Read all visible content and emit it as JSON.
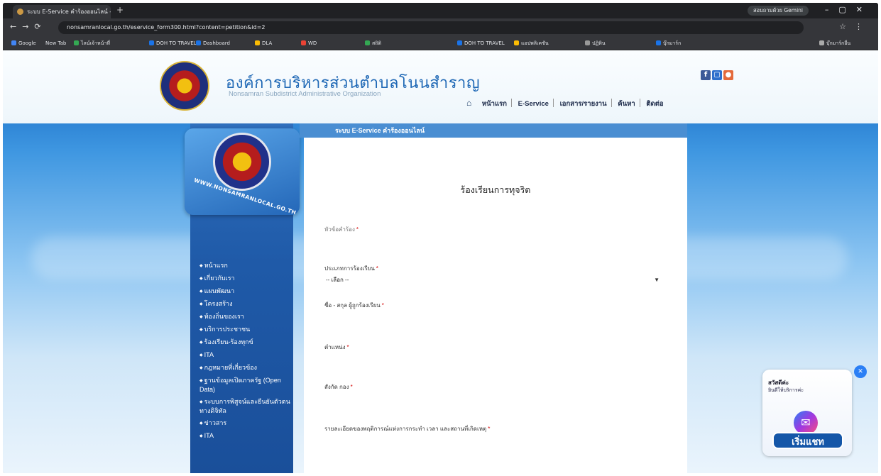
{
  "browser": {
    "tab_title": "ระบบ E-Service คำร้องออนไลน์ - ×",
    "gemini_label": "สอบถามด้วย Gemini",
    "address": "nonsamranlocal.go.th/eservice_form300.html?content=petition&id=2",
    "bookmarks": [
      "Google",
      "New Tab",
      "ไลน์เจ้าหน้าที่",
      "DOH TO TRAVEL",
      "Dashboard",
      "DLA",
      "WD",
      "สถิติ",
      "DOH TO TRAVEL",
      "แอปพลิเคชัน",
      "ปฏิทิน",
      "บุ๊กมาร์ก"
    ],
    "all_bookmarks": "บุ๊กมาร์กอื่น"
  },
  "header": {
    "site_title": "องค์การบริหารส่วนตำบลโนนสำราญ",
    "site_subtitle": "Nonsamran Subdistrict Administrative Organization",
    "nav": [
      "หน้าแรก",
      "E-Service",
      "เอกสาร/รายงาน",
      "ค้นหา",
      "ติดต่อ"
    ]
  },
  "band": {
    "eservice_title": "ระบบ E-Service คำร้องออนไลน์",
    "emblem_text": "WWW.NONSAMRANLOCAL.GO.TH"
  },
  "sidebar": {
    "items": [
      "หน้าแรก",
      "เกี่ยวกับเรา",
      "แผนพัฒนา",
      "โครงสร้าง",
      "ท้องถิ่นของเรา",
      "บริการประชาชน",
      "ร้องเรียน-ร้องทุกข์",
      "ITA",
      "กฎหมายที่เกี่ยวข้อง",
      "ฐานข้อมูลเปิดภาครัฐ (Open Data)",
      "ระบบการพิสูจน์และยืนยันตัวตนทางดิจิทัล",
      "ข่าวสาร",
      "ITA"
    ]
  },
  "form": {
    "title": "ร้องเรียนการทุจริต",
    "field_subject": "หัวข้อคำร้อง",
    "field_type": "ประเภทการร้องเรียน",
    "select_value": "-- เลือก --",
    "field_name": "ชื่อ - สกุล ผู้ถูกร้องเรียน",
    "field_position": "ตำแหน่ง",
    "field_dept": "สังกัด กอง",
    "field_details": "รายละเอียดของพฤติการณ์แห่งการกระทำ เวลา และสถานที่เกิดเหตุ",
    "required_mark": "*"
  },
  "chat": {
    "line1": "สวัสดีค่ะ",
    "line2": "ยินดีให้บริการค่ะ",
    "button": "เริ่มแชท"
  }
}
